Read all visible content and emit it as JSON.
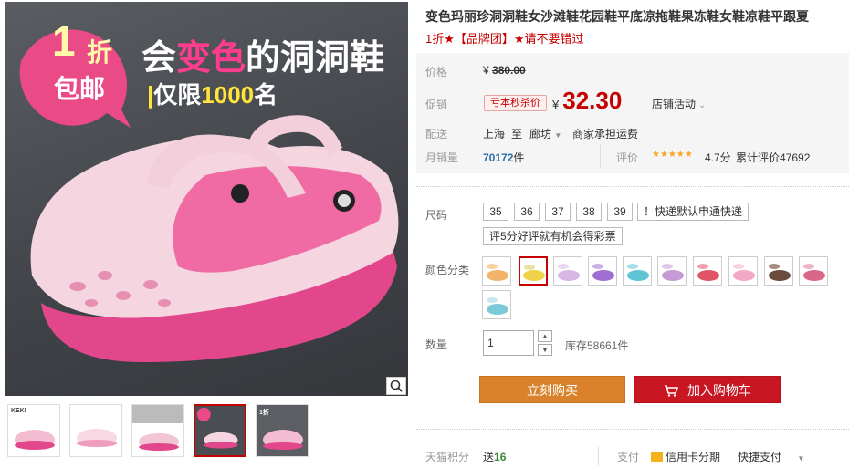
{
  "banner": {
    "discount_num": "1",
    "discount_unit": "折",
    "free_shipping": "包邮",
    "headline_prefix": "会",
    "headline_highlight": "变色",
    "headline_suffix": "的洞洞鞋",
    "subline_bar": "|",
    "subline_prefix": "仅限",
    "subline_highlight": "1000",
    "subline_suffix": "名"
  },
  "gallery": {
    "thumbs": [
      {
        "label": "KEKI",
        "active": false
      },
      {
        "label": "",
        "active": false
      },
      {
        "label": "",
        "active": false
      },
      {
        "label": "",
        "active": true
      },
      {
        "label": "1折",
        "active": false
      }
    ]
  },
  "product": {
    "title": "变色玛丽珍洞洞鞋女沙滩鞋花园鞋平底凉拖鞋果冻鞋女鞋凉鞋平跟夏",
    "subtitle": "1折★【品牌团】★请不要错过"
  },
  "price": {
    "label": "价格",
    "currency": "¥",
    "original": "380.00",
    "promo_label": "促销",
    "promo_tag": "亏本秒杀价",
    "promo_price": "32.30",
    "store_activity": "店铺活动"
  },
  "shipping": {
    "label": "配送",
    "from": "上海",
    "to_word": "至",
    "to": "廊坊",
    "fee": "商家承担运费"
  },
  "sales": {
    "label": "月销量",
    "count": "70172",
    "unit": "件",
    "rating_label": "评价",
    "stars": "★★★★★",
    "score": "4.7分",
    "review_total": "累计评价47692"
  },
  "options": {
    "size_label": "尺码",
    "sizes": [
      "35",
      "36",
      "37",
      "38",
      "39"
    ],
    "shipping_note": "！快递默认申通快递",
    "review_note": "评5分好评就有机会得彩票",
    "color_label": "颜色分类"
  },
  "quantity": {
    "label": "数量",
    "value": "1",
    "stock": "库存58661件"
  },
  "actions": {
    "buy_now": "立刻购买",
    "add_cart": "加入购物车"
  },
  "footer": {
    "points_label": "天猫积分",
    "points_prefix": "送",
    "points_value": "16",
    "pay_label": "支付",
    "credit_card": "信用卡分期",
    "quick_pay": "快捷支付"
  },
  "colors": {
    "accent_red": "#c40000",
    "buy_orange": "#d9822b",
    "cart_red": "#c91623",
    "star_orange": "#f5a623"
  }
}
